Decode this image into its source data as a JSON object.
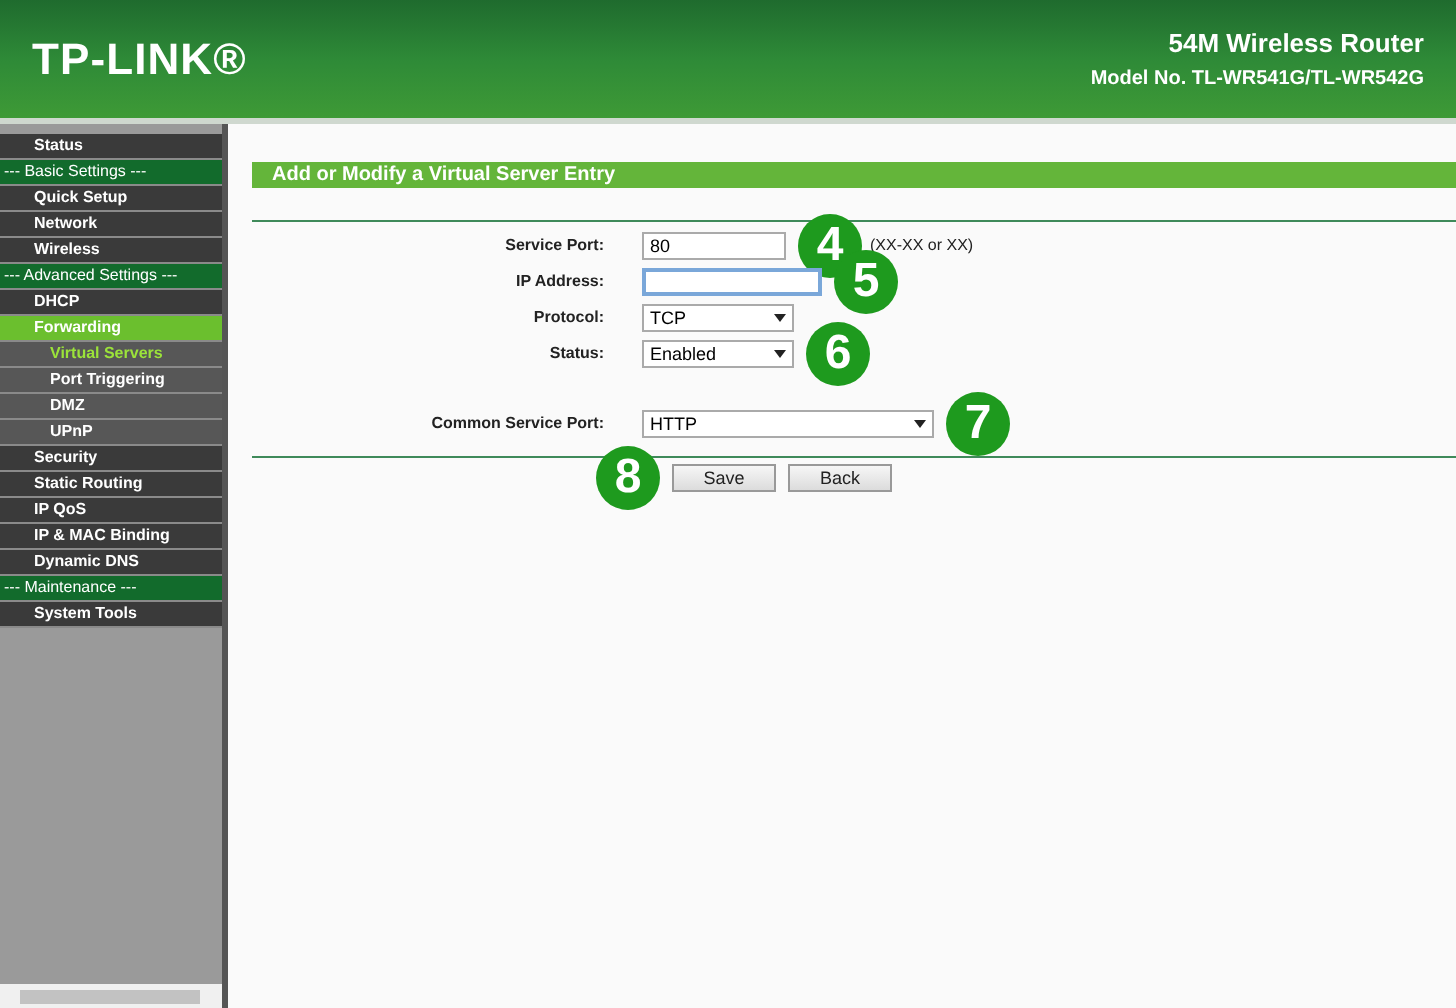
{
  "header": {
    "logo": "TP-LINK®",
    "product": "54M Wireless Router",
    "model": "Model No. TL-WR541G/TL-WR542G"
  },
  "sidebar": {
    "items": [
      {
        "label": "Status",
        "kind": "item",
        "selected": false
      },
      {
        "label": "--- Basic Settings ---",
        "kind": "section"
      },
      {
        "label": "Quick Setup",
        "kind": "item",
        "selected": false
      },
      {
        "label": "Network",
        "kind": "item",
        "selected": false
      },
      {
        "label": "Wireless",
        "kind": "item",
        "selected": false
      },
      {
        "label": "--- Advanced Settings ---",
        "kind": "section"
      },
      {
        "label": "DHCP",
        "kind": "item",
        "selected": false
      },
      {
        "label": "Forwarding",
        "kind": "item",
        "selected": true
      },
      {
        "label": "Virtual Servers",
        "kind": "sub",
        "selected": true
      },
      {
        "label": "Port Triggering",
        "kind": "sub",
        "selected": false
      },
      {
        "label": "DMZ",
        "kind": "sub",
        "selected": false
      },
      {
        "label": "UPnP",
        "kind": "sub",
        "selected": false
      },
      {
        "label": "Security",
        "kind": "item",
        "selected": false
      },
      {
        "label": "Static Routing",
        "kind": "item",
        "selected": false
      },
      {
        "label": "IP QoS",
        "kind": "item",
        "selected": false
      },
      {
        "label": "IP & MAC Binding",
        "kind": "item",
        "selected": false
      },
      {
        "label": "Dynamic DNS",
        "kind": "item",
        "selected": false
      },
      {
        "label": "--- Maintenance ---",
        "kind": "section"
      },
      {
        "label": "System Tools",
        "kind": "item",
        "selected": false
      }
    ]
  },
  "form": {
    "title": "Add or Modify a Virtual Server Entry",
    "fields": [
      {
        "label": "Service Port:",
        "kind": "text",
        "value": "80",
        "hint": "(XX-XX or XX)",
        "step": "4"
      },
      {
        "label": "IP Address:",
        "kind": "text",
        "focused": true,
        "step": "5"
      },
      {
        "label": "Protocol:",
        "kind": "select",
        "value": "TCP"
      },
      {
        "label": "Status:",
        "kind": "select",
        "value": "Enabled",
        "step": "6"
      },
      {
        "label": "Common Service Port:",
        "kind": "wide-select",
        "value": "HTTP",
        "step": "7"
      }
    ],
    "buttons": [
      "Save",
      "Back"
    ],
    "buttons_step": "8"
  }
}
